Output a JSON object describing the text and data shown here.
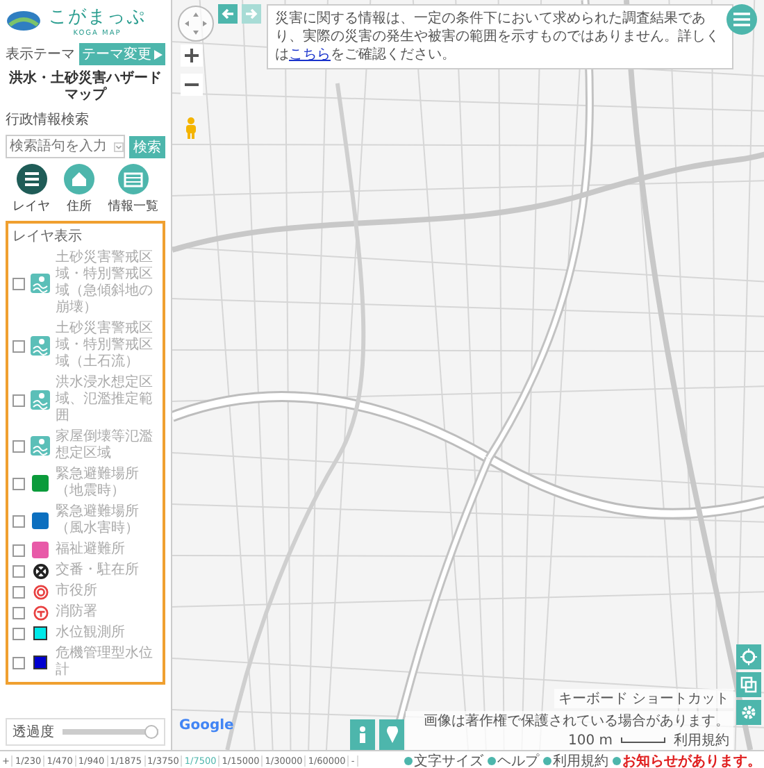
{
  "header": {
    "title": "こがまっぷ",
    "subtitle": "KOGA MAP"
  },
  "theme": {
    "label": "表示テーマ",
    "change_button": "テーマ変更",
    "current": "洪水・土砂災害ハザードマップ"
  },
  "search": {
    "label": "行政情報検索",
    "placeholder": "検索語句を入力",
    "button": "検索"
  },
  "nav": [
    {
      "label": "レイヤ",
      "kind": "layers",
      "selected": true
    },
    {
      "label": "住所",
      "kind": "home",
      "selected": false
    },
    {
      "label": "情報一覧",
      "kind": "list",
      "selected": false
    }
  ],
  "layers": {
    "title": "レイヤ表示",
    "items": [
      {
        "label": "土砂災害警戒区域・特別警戒区域（急傾斜地の崩壊）",
        "kind": "hazard",
        "checked": false
      },
      {
        "label": "土砂災害警戒区域・特別警戒区域（土石流）",
        "kind": "hazard",
        "checked": false
      },
      {
        "label": "洪水浸水想定区域、氾濫推定範囲",
        "kind": "hazard",
        "checked": false
      },
      {
        "label": "家屋倒壊等氾濫想定区域",
        "kind": "hazard",
        "checked": false
      },
      {
        "label": "緊急避難場所（地震時）",
        "kind": "square",
        "color": "#0b9b3b",
        "checked": false
      },
      {
        "label": "緊急避難場所（風水害時）",
        "kind": "square",
        "color": "#0c6fbf",
        "checked": false
      },
      {
        "label": "福祉避難所",
        "kind": "square",
        "color": "#e85aa8",
        "checked": false
      },
      {
        "label": "交番・駐在所",
        "kind": "police",
        "checked": false
      },
      {
        "label": "市役所",
        "kind": "cityhall",
        "checked": false
      },
      {
        "label": "消防署",
        "kind": "fire",
        "checked": false
      },
      {
        "label": "水位観測所",
        "kind": "outlined",
        "color": "#00e8e8",
        "checked": false
      },
      {
        "label": "危機管理型水位計",
        "kind": "outlined",
        "color": "#0000d0",
        "checked": false
      }
    ]
  },
  "transparency": {
    "label": "透過度",
    "level": 1.0
  },
  "scales": {
    "zoom_in": "+",
    "zoom_out": "-",
    "items": [
      {
        "label": "1/230",
        "selected": false
      },
      {
        "label": "1/470",
        "selected": false
      },
      {
        "label": "1/940",
        "selected": false
      },
      {
        "label": "1/1875",
        "selected": false
      },
      {
        "label": "1/3750",
        "selected": false
      },
      {
        "label": "1/7500",
        "selected": true
      },
      {
        "label": "1/15000",
        "selected": false
      },
      {
        "label": "1/30000",
        "selected": false
      },
      {
        "label": "1/60000",
        "selected": false
      }
    ]
  },
  "history": [
    {
      "kind": "back",
      "disabled": false
    },
    {
      "kind": "forward",
      "disabled": true
    }
  ],
  "notice": {
    "before": "災害に関する情報は、一定の条件下において求められた調査結果であり、実際の災害の発生や被害の範囲を示すものではありません。詳しくは",
    "link": "こちら",
    "after": "をご確認ください。"
  },
  "map": {
    "provider": "Google",
    "shortcuts": "キーボード ショートカット",
    "copyright": "画像は著作権で保護されている場合があります。",
    "scale": "100 m",
    "terms": "利用規約"
  },
  "footer": [
    {
      "label": "文字サイズ",
      "kind": "normal"
    },
    {
      "label": "ヘルプ",
      "kind": "normal"
    },
    {
      "label": "利用規約",
      "kind": "normal"
    },
    {
      "label": "お知らせがあります。",
      "kind": "alert"
    }
  ]
}
